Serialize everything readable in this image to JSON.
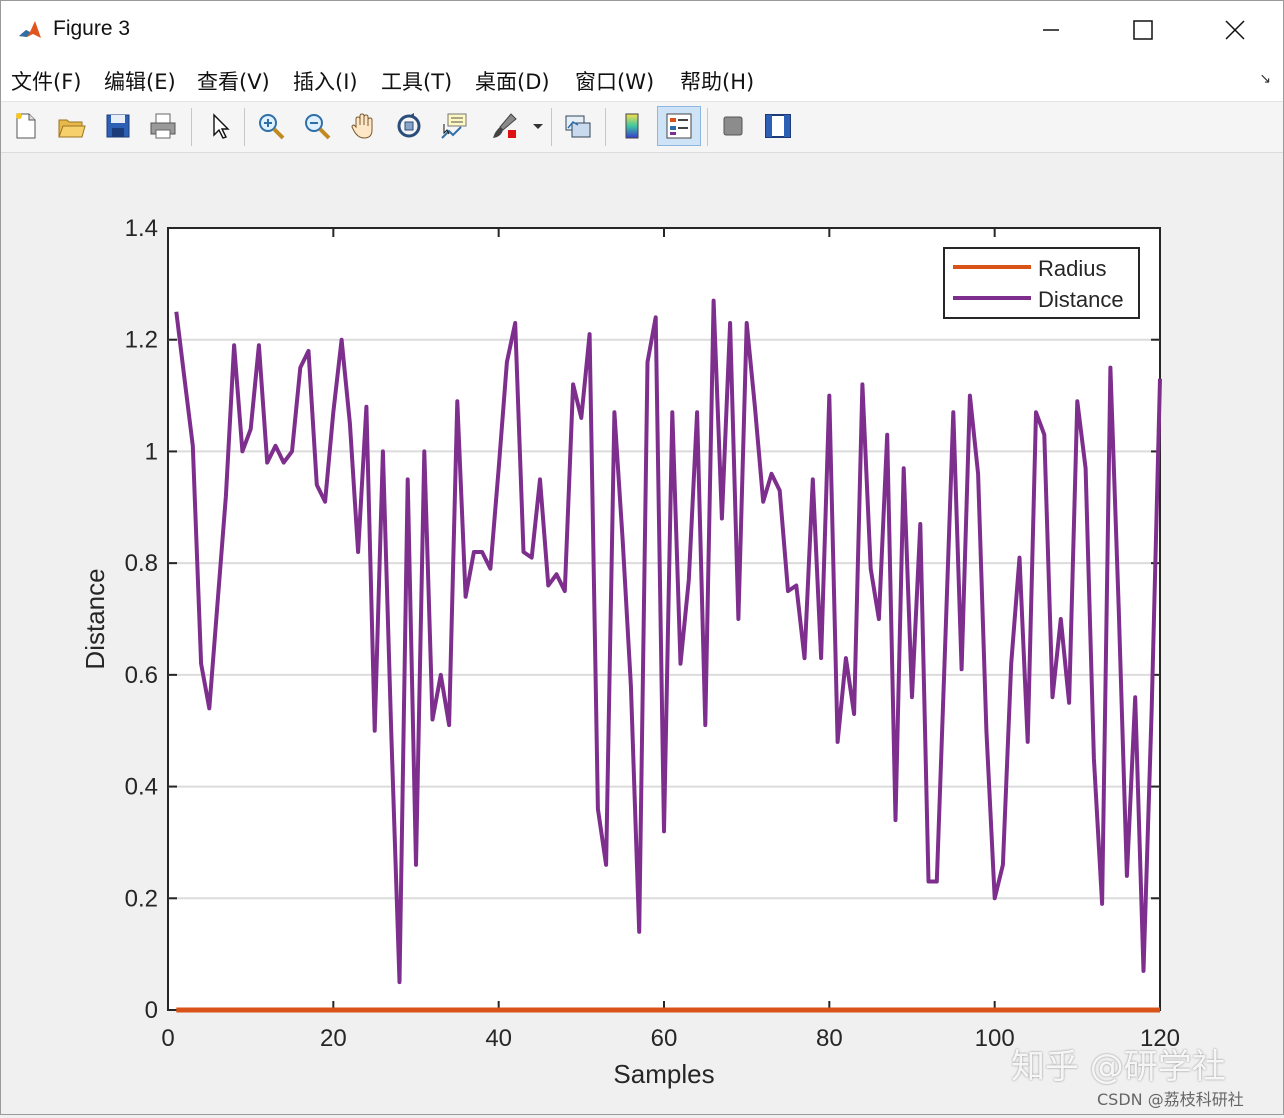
{
  "window": {
    "title": "Figure 3"
  },
  "menu": [
    "文件(F)",
    "编辑(E)",
    "查看(V)",
    "插入(I)",
    "工具(T)",
    "桌面(D)",
    "窗口(W)",
    "帮助(H)"
  ],
  "toolbar_icons": [
    "new-figure-icon",
    "open-file-icon",
    "save-icon",
    "print-icon",
    "select-arrow-icon",
    "zoom-in-icon",
    "zoom-out-icon",
    "pan-hand-icon",
    "rotate-3d-icon",
    "data-cursor-icon",
    "brush-icon",
    "brush-dropdown-icon",
    "link-plot-icon",
    "colorbar-icon",
    "legend-icon",
    "hide-plot-tools-icon",
    "show-plot-tools-icon"
  ],
  "watermark": {
    "main": "知乎 @研学社",
    "sub": "CSDN @荔枝科研社"
  },
  "chart_data": {
    "type": "line",
    "xlabel": "Samples",
    "ylabel": "Distance",
    "xlim": [
      0,
      120
    ],
    "ylim": [
      0,
      1.4
    ],
    "xticks": [
      "0",
      "20",
      "40",
      "60",
      "80",
      "100",
      "120"
    ],
    "yticks": [
      "0",
      "0.2",
      "0.4",
      "0.6",
      "0.8",
      "1",
      "1.2",
      "1.4"
    ],
    "grid": "horizontal",
    "legend_position": "top-right",
    "series": [
      {
        "name": "Radius",
        "color": "#d95319",
        "x": [
          1,
          120
        ],
        "values": [
          0,
          0
        ]
      },
      {
        "name": "Distance",
        "color": "#7e2f8e",
        "x": [
          1,
          2,
          3,
          4,
          5,
          6,
          7,
          8,
          9,
          10,
          11,
          12,
          13,
          14,
          15,
          16,
          17,
          18,
          19,
          20,
          21,
          22,
          23,
          24,
          25,
          26,
          27,
          28,
          29,
          30,
          31,
          32,
          33,
          34,
          35,
          36,
          37,
          38,
          39,
          40,
          41,
          42,
          43,
          44,
          45,
          46,
          47,
          48,
          49,
          50,
          51,
          52,
          53,
          54,
          55,
          56,
          57,
          58,
          59,
          60,
          61,
          62,
          63,
          64,
          65,
          66,
          67,
          68,
          69,
          70,
          71,
          72,
          73,
          74,
          75,
          76,
          77,
          78,
          79,
          80,
          81,
          82,
          83,
          84,
          85,
          86,
          87,
          88,
          89,
          90,
          91,
          92,
          93,
          94,
          95,
          96,
          97,
          98,
          99,
          100,
          101,
          102,
          103,
          104,
          105,
          106,
          107,
          108,
          109,
          110,
          111,
          112,
          113,
          114,
          115,
          116,
          117,
          118,
          119,
          120
        ],
        "values": [
          1.25,
          1.13,
          1.01,
          0.62,
          0.54,
          0.73,
          0.92,
          1.19,
          1.0,
          1.04,
          1.19,
          0.98,
          1.01,
          0.98,
          1.0,
          1.15,
          1.18,
          0.94,
          0.91,
          1.07,
          1.2,
          1.05,
          0.82,
          1.08,
          0.5,
          1.0,
          0.5,
          0.05,
          0.95,
          0.26,
          1.0,
          0.52,
          0.6,
          0.51,
          1.09,
          0.74,
          0.82,
          0.82,
          0.79,
          0.97,
          1.16,
          1.23,
          0.82,
          0.81,
          0.95,
          0.76,
          0.78,
          0.75,
          1.12,
          1.06,
          1.21,
          0.36,
          0.26,
          1.07,
          0.84,
          0.58,
          0.14,
          1.16,
          1.24,
          0.32,
          1.07,
          0.62,
          0.77,
          1.07,
          0.51,
          1.27,
          0.88,
          1.23,
          0.7,
          1.23,
          1.08,
          0.91,
          0.96,
          0.93,
          0.75,
          0.76,
          0.63,
          0.95,
          0.63,
          1.1,
          0.48,
          0.63,
          0.53,
          1.12,
          0.79,
          0.7,
          1.03,
          0.34,
          0.97,
          0.56,
          0.87,
          0.23,
          0.23,
          0.65,
          1.07,
          0.61,
          1.1,
          0.96,
          0.5,
          0.2,
          0.26,
          0.62,
          0.81,
          0.48,
          1.07,
          1.03,
          0.56,
          0.7,
          0.55,
          1.09,
          0.97,
          0.45,
          0.19,
          1.15,
          0.72,
          0.24,
          0.56,
          0.07,
          0.54,
          1.13
        ]
      }
    ]
  }
}
